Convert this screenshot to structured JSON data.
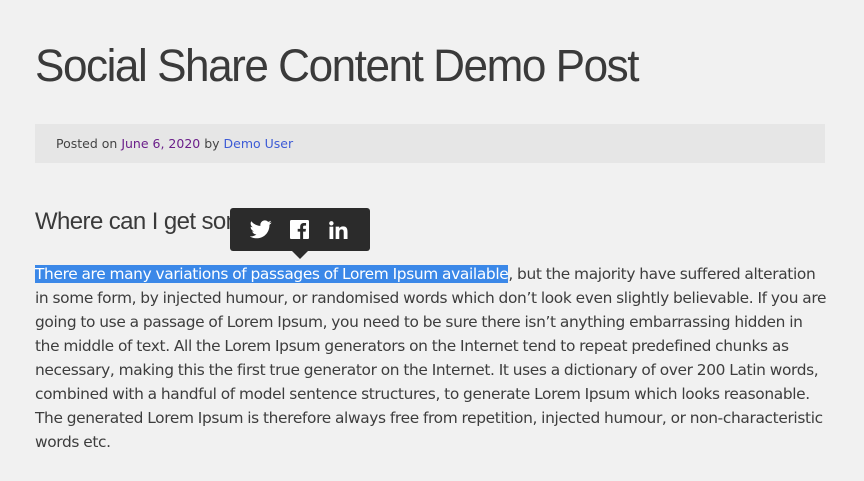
{
  "post": {
    "title": "Social Share Content Demo Post",
    "meta": {
      "posted_on_label": "Posted on",
      "date": "June 6, 2020",
      "by_label": "by",
      "author": "Demo User"
    },
    "section_heading": "Where can I get some?",
    "paragraph": {
      "selected_text": "There are many variations of passages of Lorem Ipsum available",
      "rest_text": ", but the majority have suffered alteration in some form, by injected humour, or randomised words which don’t look even slightly believable. If you are going to use a passage of Lorem Ipsum, you need to be sure there isn’t anything embarrassing hidden in the middle of text. All the Lorem Ipsum generators on the Internet tend to repeat predefined chunks as necessary, making this the first true generator on the Internet. It uses a dictionary of over 200 Latin words, combined with a handful of model sentence structures, to generate Lorem Ipsum which looks reasonable. The generated Lorem Ipsum is therefore always free from repetition, injected humour, or non-characteristic words etc."
    }
  },
  "share_popup": {
    "buttons": [
      {
        "icon": "twitter-icon"
      },
      {
        "icon": "facebook-icon"
      },
      {
        "icon": "linkedin-icon"
      }
    ]
  },
  "colors": {
    "background": "#f1f1f1",
    "meta_bar": "#e6e6e6",
    "date_link": "#6b1f8a",
    "author_link": "#3d5bd6",
    "selection": "#3b88e8",
    "popup": "#2b2b2b"
  }
}
